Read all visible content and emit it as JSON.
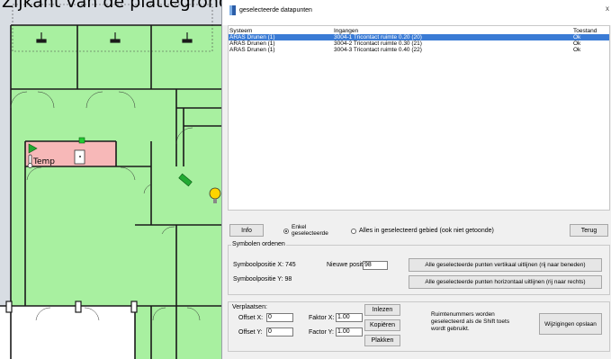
{
  "plan": {
    "heading": "Zijkant van de plattegrond",
    "temp_label": "Temp"
  },
  "dialog": {
    "title": "geselecteerde datapunten",
    "close_glyph": "x",
    "table": {
      "columns": [
        "Systeem",
        "Ingangen",
        "Toestand"
      ],
      "rows": [
        {
          "systeem": "ARAS Drunen (1)",
          "ingang": "3004-1 Tricontact ruimte 0.20 (20)",
          "toestand": "Ok",
          "selected": true
        },
        {
          "systeem": "ARAS Drunen (1)",
          "ingang": "3004-2 Tricontact ruimte 0.30 (21)",
          "toestand": "Ok",
          "selected": false
        },
        {
          "systeem": "ARAS Drunen (1)",
          "ingang": "3004-3 Tricontact ruimte 0.40 (22)",
          "toestand": "Ok",
          "selected": false
        }
      ]
    },
    "info_button": "Info",
    "radio_enkel": "Enkel\ngeselecteerde",
    "radio_alles": "Alles in geselecteerd gebied (ook niet getoonde)",
    "terug_button": "Terug",
    "symbolen": {
      "title": "Symbolen ordenen",
      "pos_x_label": "Symboolpositie X: 745",
      "pos_y_label": "Symboolpositie Y: 98",
      "nieuwe_label": "Nieuwe positie:",
      "nieuwe_value": "98",
      "vertical_button": "Alle geselecteerde punten vertikaal uitlijnen (rij naar beneden)",
      "horizontal_button": "Alle geselecteerde punten horizontaal uitlijnen (rij naar rechts)"
    },
    "verplaatsen": {
      "title": "Verplaatsen:",
      "offset_x_label": "Offset X:",
      "offset_x_value": "0",
      "offset_y_label": "Offset Y:",
      "offset_y_value": "0",
      "factor_x_label": "Faktor X:",
      "factor_x_value": "1.00",
      "factor_y_label": "Factor Y:",
      "factor_y_value": "1.00",
      "inlezen_button": "Inlezen",
      "kopieren_button": "Kopiëren",
      "plakken_button": "Plakken",
      "note": "Ruimtenummers worden\ngeselecteerd als de Shift toets\nwordt gebruikt.",
      "opslaan_button": "Wijzigingen opslaan"
    }
  },
  "colors": {
    "room_green": "#a8f0a0",
    "room_pink": "#f7b8b8",
    "selection_blue": "#3a7bd5",
    "wall": "#1a1a1a"
  }
}
